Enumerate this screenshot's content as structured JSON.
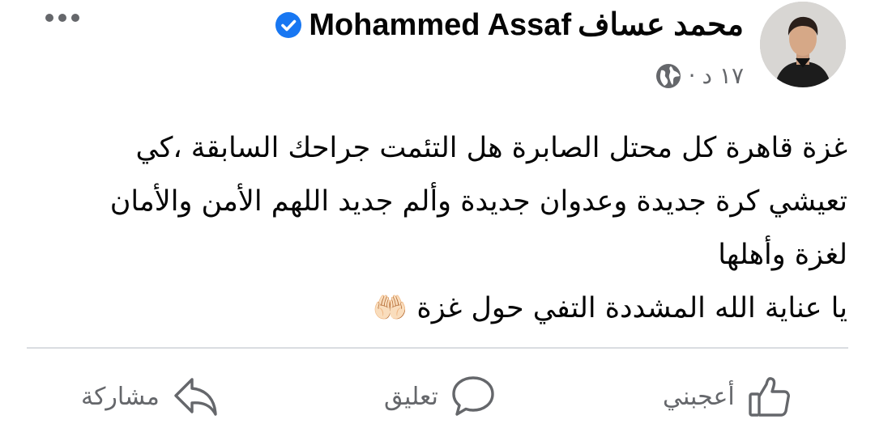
{
  "post": {
    "author_arabic": "محمد عساف",
    "author_latin": "Mohammed Assaf",
    "time": "١٧ د",
    "separator": "·",
    "verified": true,
    "lines": [
      "غزة قاهرة كل محتل الصابرة هل التئمت جراحك السابقة ،كي",
      "تعيشي كرة جديدة وعدوان جديدة وألم جديد اللهم الأمن والأمان",
      "لغزة وأهلها",
      "يا عناية الله المشددة التفي حول غزة 🤲🏻"
    ]
  },
  "actions": {
    "like": "أعجبني",
    "comment": "تعليق",
    "share": "مشاركة"
  },
  "icons": {
    "more": "more-dots-icon",
    "verified": "verified-badge-icon",
    "privacy": "globe-icon",
    "like": "thumbs-up-icon",
    "comment": "comment-bubble-icon",
    "share": "share-arrow-icon"
  },
  "colors": {
    "verified": "#1877f2",
    "secondary_text": "#65676b",
    "primary_text": "#050505",
    "divider": "#dadde1"
  }
}
